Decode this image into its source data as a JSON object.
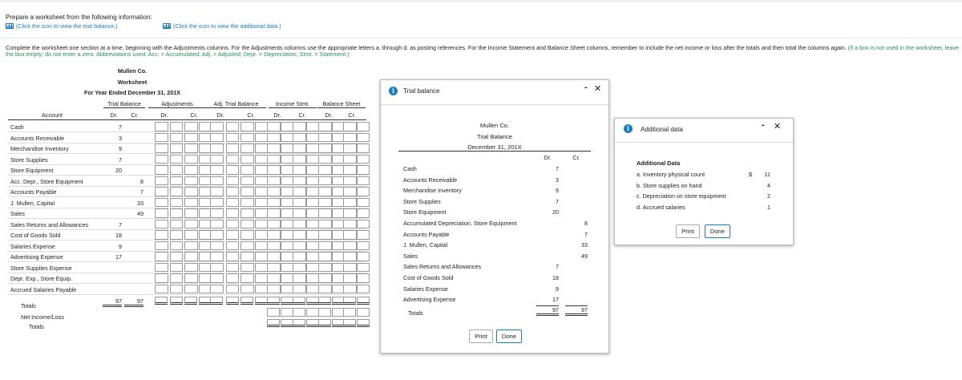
{
  "intro": {
    "line1": "Prepare a worksheet from the following information:",
    "link_trial": "(Click the icon to view the trial balance.)",
    "link_additional": "(Click the icon to view the additional data.)"
  },
  "instructions": {
    "main": "Complete the worksheet one section at a time, beginning with the Adjustments columns. For the Adjustments columns use the appropriate letters a. through d. as posting references. For the Income Statement and Balance Sheet columns, remember to include the net income or loss after the totals and then total the columns again.",
    "hint": "(If a box is not used in the worksheet, leave the box empty; do not enter a zero. Abbreviations used: Acc. = Accumulated; Adj. = Adjusted; Depr. = Depreciation; Stmt. = Statement.)"
  },
  "worksheet": {
    "company": "Mullen Co.",
    "title": "Worksheet",
    "period": "For Year Ended December 31, 201X",
    "groups": [
      "Trial Balance",
      "Adjustments",
      "Adj. Trial Balance",
      "Income Stmt.",
      "Balance Sheet"
    ],
    "account_header": "Account",
    "dr": "Dr.",
    "cr": "Cr.",
    "rows": [
      {
        "account": "Cash",
        "dr": "7",
        "cr": ""
      },
      {
        "account": "Accounts Receivable",
        "dr": "3",
        "cr": ""
      },
      {
        "account": "Merchandise Inventory",
        "dr": "9",
        "cr": ""
      },
      {
        "account": "Store Supplies",
        "dr": "7",
        "cr": ""
      },
      {
        "account": "Store Equipment",
        "dr": "20",
        "cr": ""
      },
      {
        "account": "Acc. Depr., Store Equipment",
        "dr": "",
        "cr": "8"
      },
      {
        "account": "Accounts Payable",
        "dr": "",
        "cr": "7"
      },
      {
        "account": "J. Mullen, Capital",
        "dr": "",
        "cr": "33"
      },
      {
        "account": "Sales",
        "dr": "",
        "cr": "49"
      },
      {
        "account": "Sales Returns and Allowances",
        "dr": "7",
        "cr": ""
      },
      {
        "account": "Cost of Goods Sold",
        "dr": "18",
        "cr": ""
      },
      {
        "account": "Salaries Expense",
        "dr": "9",
        "cr": ""
      },
      {
        "account": "Advertising Expense",
        "dr": "17",
        "cr": ""
      },
      {
        "account": "Store Supplies Expense",
        "dr": "",
        "cr": ""
      },
      {
        "account": "Depr. Exp., Store Equip.",
        "dr": "",
        "cr": ""
      },
      {
        "account": "Accrued Salaries Payable",
        "dr": "",
        "cr": ""
      }
    ],
    "totals_label": "Totals",
    "totals_dr": "97",
    "totals_cr": "97",
    "net_label": "Net Income/Loss",
    "totals2_label": "Totals"
  },
  "trial_dialog": {
    "title": "Trial balance",
    "company": "Mullen Co.",
    "heading": "Trial Balance",
    "date": "December 31, 201X",
    "dr": "Dr.",
    "cr": "Cr.",
    "rows": [
      {
        "account": "Cash",
        "dr": "7",
        "cr": ""
      },
      {
        "account": "Accounts Receivable",
        "dr": "3",
        "cr": ""
      },
      {
        "account": "Merchandise Inventory",
        "dr": "9",
        "cr": ""
      },
      {
        "account": "Store Supplies",
        "dr": "7",
        "cr": ""
      },
      {
        "account": "Store Equipment",
        "dr": "20",
        "cr": ""
      },
      {
        "account": "Accumulated Depreciation, Store Equipment",
        "dr": "",
        "cr": "8"
      },
      {
        "account": "Accounts Payable",
        "dr": "",
        "cr": "7"
      },
      {
        "account": "J. Mullen, Capital",
        "dr": "",
        "cr": "33"
      },
      {
        "account": "Sales",
        "dr": "",
        "cr": "49"
      },
      {
        "account": "Sales Returns and Allowances",
        "dr": "7",
        "cr": ""
      },
      {
        "account": "Cost of Goods Sold",
        "dr": "18",
        "cr": ""
      },
      {
        "account": "Salaries Expense",
        "dr": "9",
        "cr": ""
      },
      {
        "account": "Advertising Expense",
        "dr": "17",
        "cr": ""
      }
    ],
    "totals_label": "Totals",
    "totals_dr": "97",
    "totals_cr": "97",
    "print": "Print",
    "done": "Done"
  },
  "additional_dialog": {
    "title": "Additional data",
    "heading": "Additional Data",
    "items": [
      {
        "label": "a.  Inventory physical count",
        "currency": "$",
        "value": "11"
      },
      {
        "label": "b.  Store supplies on hand",
        "currency": "",
        "value": "4"
      },
      {
        "label": "c.  Depreciation on store equipment",
        "currency": "",
        "value": "2"
      },
      {
        "label": "d.  Accrued salaries",
        "currency": "",
        "value": "1"
      }
    ],
    "print": "Print",
    "done": "Done"
  },
  "icons": {
    "info": "i",
    "minimize": "-",
    "close": "✕"
  },
  "colors": {
    "link": "#1a7bc0",
    "hint": "#2e8b57",
    "info": "#1a7bc0"
  }
}
